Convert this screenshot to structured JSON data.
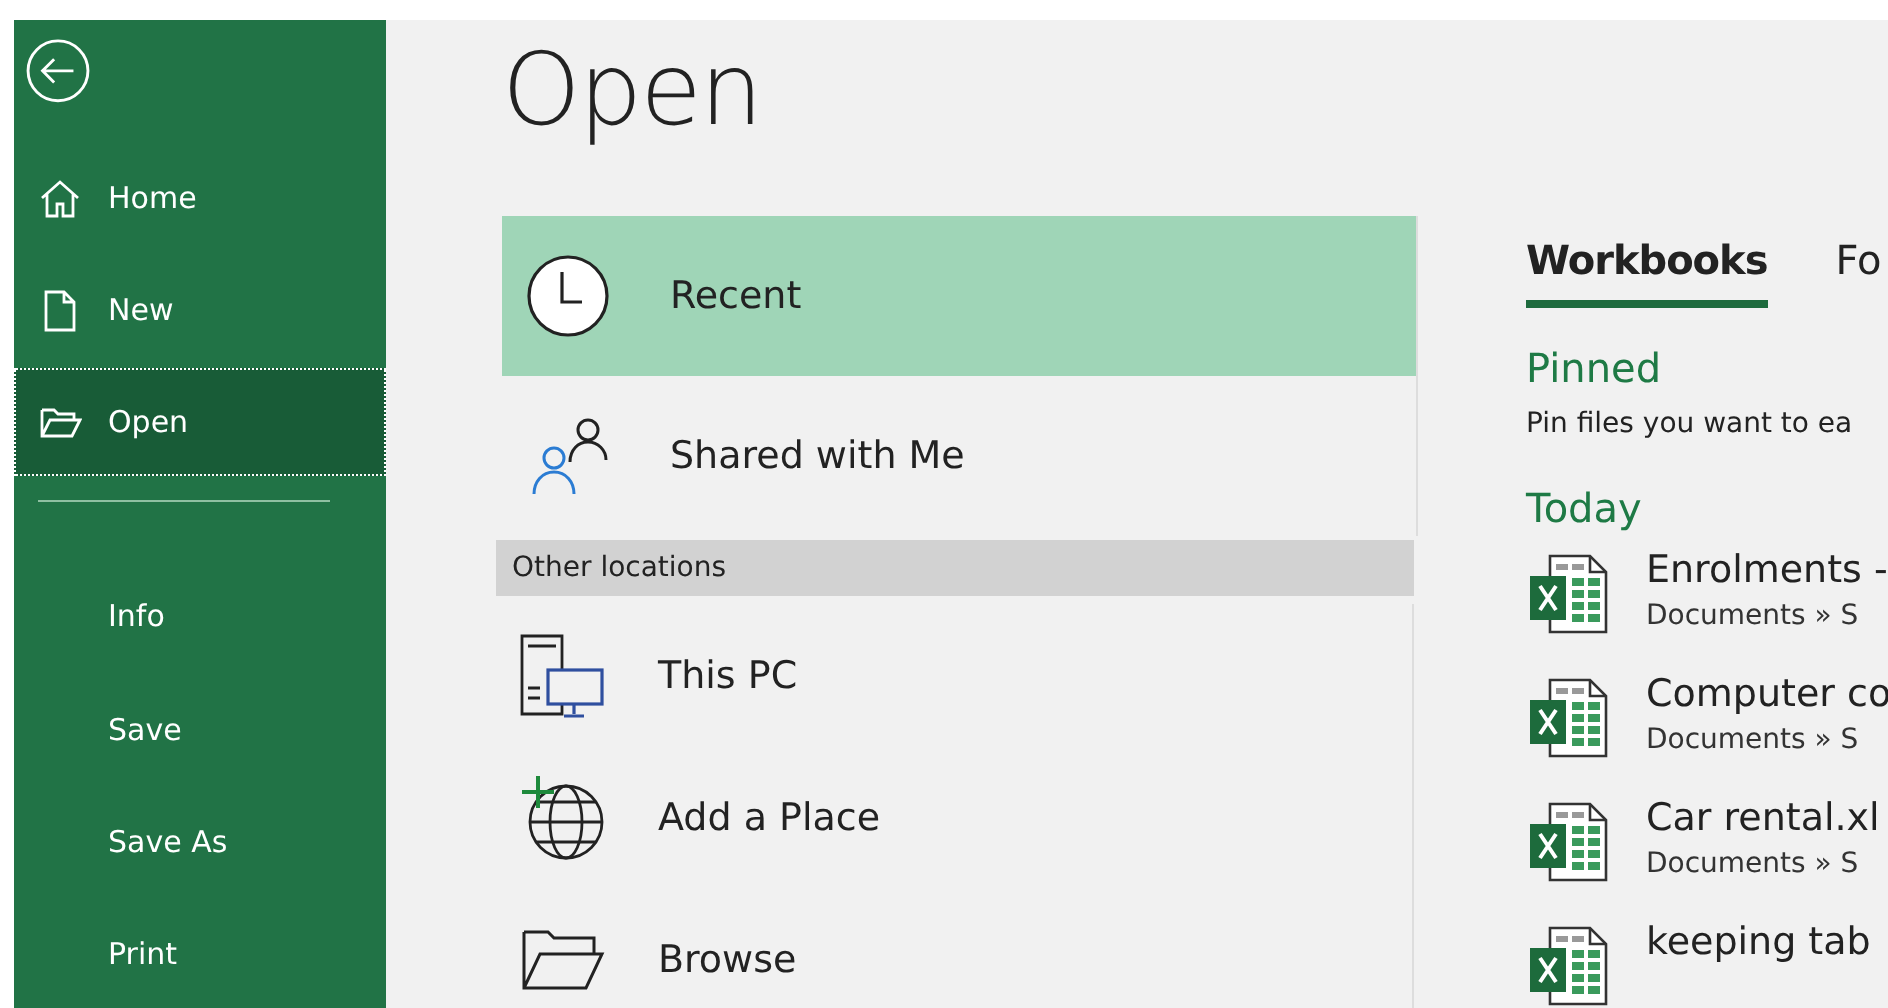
{
  "sidebar": {
    "top_items": [
      {
        "label": "Home",
        "selected": false
      },
      {
        "label": "New",
        "selected": false
      },
      {
        "label": "Open",
        "selected": true
      }
    ],
    "bottom_items": [
      {
        "label": "Info",
        "selected": false
      },
      {
        "label": "Save",
        "selected": false
      },
      {
        "label": "Save As",
        "selected": false
      },
      {
        "label": "Print",
        "selected": false
      }
    ]
  },
  "page_title": "Open",
  "locations": [
    {
      "label": "Recent",
      "selected": true
    },
    {
      "label": "Shared with Me",
      "selected": false
    }
  ],
  "other_locations": {
    "heading": "Other locations",
    "items": [
      {
        "label": "This PC",
        "selected": false
      },
      {
        "label": "Add a Place",
        "selected": false
      },
      {
        "label": "Browse",
        "selected": false
      }
    ]
  },
  "tabs": [
    {
      "label": "Workbooks",
      "selected": true
    },
    {
      "label": "Fo",
      "selected": false
    }
  ],
  "pinned": {
    "heading": "Pinned",
    "hint": "Pin files you want to ea"
  },
  "today": {
    "heading": "Today",
    "files": [
      {
        "name": "Enrolments -",
        "path": "Documents » S"
      },
      {
        "name": "Computer co",
        "path": "Documents » S"
      },
      {
        "name": "Car rental.xl",
        "path": "Documents » S"
      },
      {
        "name": "keeping tab"
      }
    ]
  }
}
